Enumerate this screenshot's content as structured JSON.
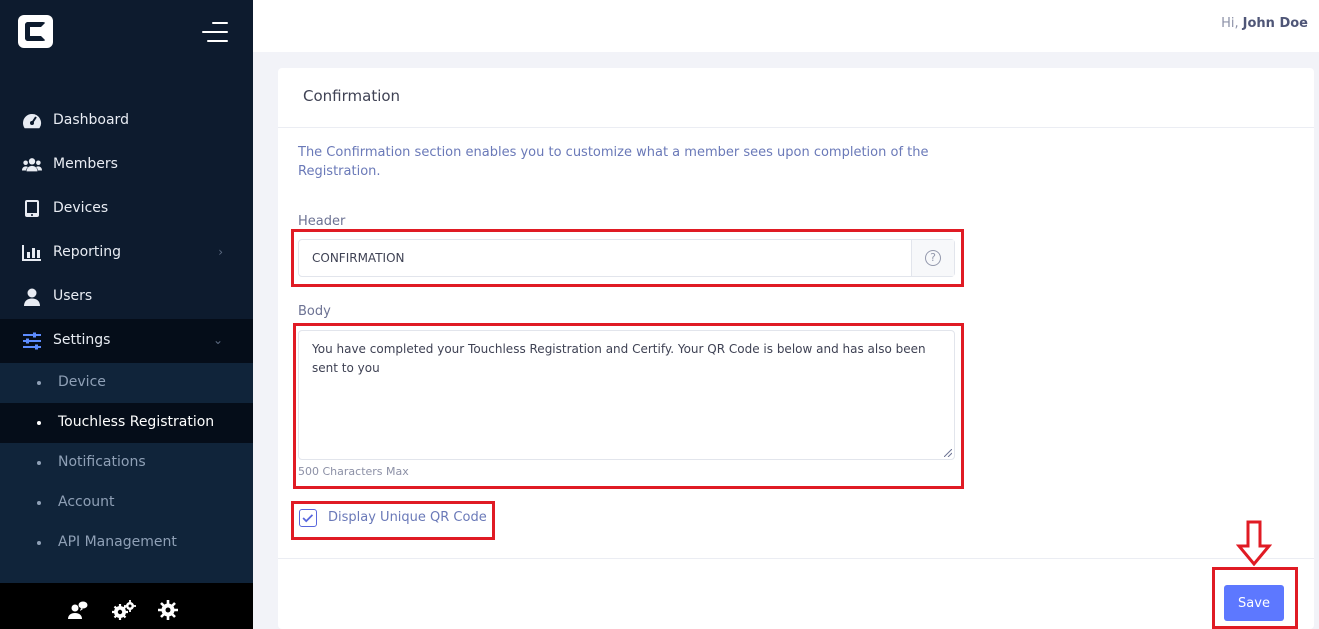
{
  "sidebar": {
    "logo_icon": "c-logo-icon",
    "menu_icon": "hamburger-icon",
    "items": [
      {
        "label": "Dashboard",
        "icon": "speedometer-icon"
      },
      {
        "label": "Members",
        "icon": "users-icon"
      },
      {
        "label": "Devices",
        "icon": "tablet-icon"
      },
      {
        "label": "Reporting",
        "icon": "bar-chart-icon",
        "chevron": "›"
      },
      {
        "label": "Users",
        "icon": "user-icon"
      },
      {
        "label": "Settings",
        "icon": "sliders-icon",
        "chevron": "⌄"
      }
    ],
    "sub_items": [
      {
        "label": "Device"
      },
      {
        "label": "Touchless Registration"
      },
      {
        "label": "Notifications"
      },
      {
        "label": "Account"
      },
      {
        "label": "API Management"
      }
    ],
    "footer_icons": [
      "user-chat-icon",
      "gears-icon",
      "gear-icon"
    ]
  },
  "topbar": {
    "greeting": "Hi,",
    "user_name": "John Doe"
  },
  "card": {
    "title": "Confirmation",
    "description": "The Confirmation section enables you to customize what a member sees upon completion of the Registration.",
    "header_label": "Header",
    "header_value": "CONFIRMATION",
    "help_glyph": "?",
    "body_label": "Body",
    "body_value": "You have completed your Touchless Registration and Certify. Your QR Code is below and has also been sent to you",
    "body_hint": "500 Characters Max",
    "checkbox_label": "Display Unique QR Code",
    "checkbox_checked": true,
    "save_label": "Save"
  },
  "colors": {
    "sidebar_bg": "#0d1b2e",
    "accent": "#5d78ff",
    "annotation": "#e01b24"
  }
}
